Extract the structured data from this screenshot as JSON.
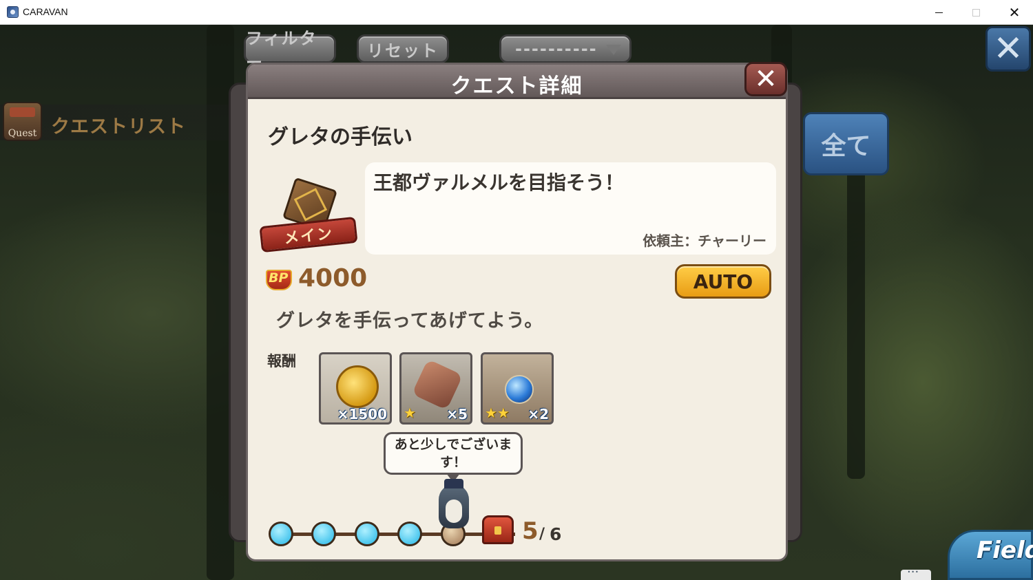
{
  "window": {
    "title": "CARAVAN"
  },
  "toolbar": {
    "filter_label": "フィルター",
    "reset_label": "リセット",
    "sort_value": "----------"
  },
  "side": {
    "quest_icon_label": "Quest",
    "quest_list_label": "クエストリスト",
    "all_label": "全て",
    "field_label": "Field"
  },
  "dialog": {
    "title": "クエスト詳細",
    "quest_name": "グレタの手伝い",
    "category_badge": "メイン",
    "description": "王都ヴァルメルを目指そう！",
    "requester": "依頼主：チャーリー",
    "bp_icon_text": "BP",
    "bp_value": "4000",
    "auto_label": "AUTO",
    "summary": "グレタを手伝ってあげてよう。",
    "rewards_label": "報酬",
    "rewards": [
      {
        "name": "gold-coin",
        "qty": "×1500",
        "stars": ""
      },
      {
        "name": "wood-logs",
        "qty": "×5",
        "stars": "★"
      },
      {
        "name": "blue-gem",
        "qty": "×2",
        "stars": "★★"
      }
    ],
    "speech": "あと少しでございます！",
    "progress": {
      "current": "5",
      "separator": "/",
      "total": "6"
    }
  }
}
